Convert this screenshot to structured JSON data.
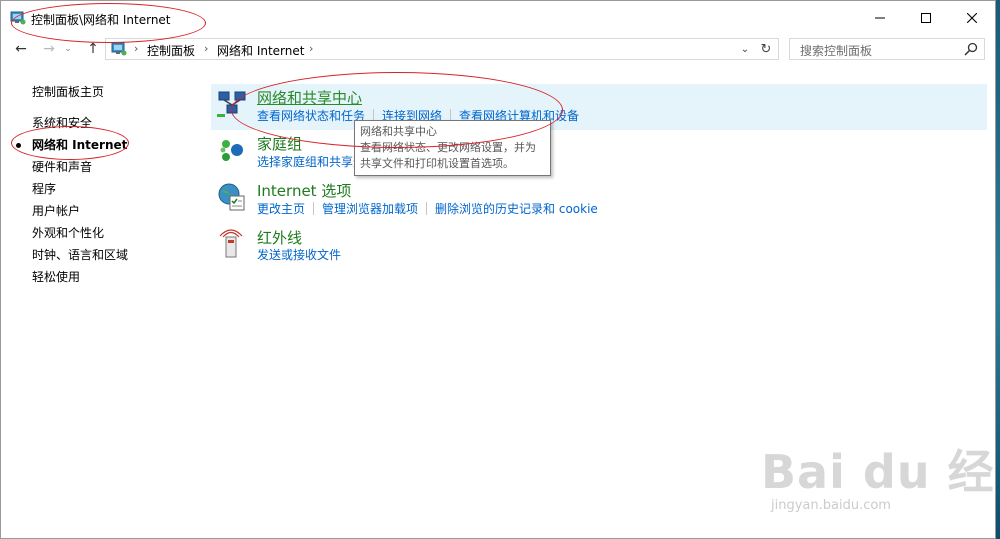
{
  "window": {
    "title": "控制面板\\网络和 Internet",
    "minimize_label": "minimize",
    "maximize_label": "maximize",
    "close_label": "close"
  },
  "address_bar": {
    "breadcrumbs": [
      "控制面板",
      "网络和 Internet"
    ],
    "separator": "›"
  },
  "search": {
    "placeholder": "搜索控制面板"
  },
  "sidebar": {
    "home": "控制面板主页",
    "items": [
      {
        "label": "系统和安全",
        "active": false
      },
      {
        "label": "网络和 Internet",
        "active": true
      },
      {
        "label": "硬件和声音",
        "active": false
      },
      {
        "label": "程序",
        "active": false
      },
      {
        "label": "用户帐户",
        "active": false
      },
      {
        "label": "外观和个性化",
        "active": false
      },
      {
        "label": "时钟、语言和区域",
        "active": false
      },
      {
        "label": "轻松使用",
        "active": false
      }
    ]
  },
  "categories": [
    {
      "title": "网络和共享中心",
      "icon": "network-sharing-center-icon",
      "links": [
        "查看网络状态和任务",
        "连接到网络",
        "查看网络计算机和设备"
      ]
    },
    {
      "title": "家庭组",
      "icon": "homegroup-icon",
      "links": [
        "选择家庭组和共享选项"
      ]
    },
    {
      "title": "Internet 选项",
      "icon": "internet-options-icon",
      "links": [
        "更改主页",
        "管理浏览器加载项",
        "删除浏览的历史记录和 cookie"
      ]
    },
    {
      "title": "红外线",
      "icon": "infrared-icon",
      "links": [
        "发送或接收文件"
      ]
    }
  ],
  "tooltip": {
    "lines": [
      "网络和共享中心",
      "查看网络状态、更改网络设置，并为",
      "共享文件和打印机设置首选项。"
    ]
  },
  "watermark": {
    "logo": "Bai du 经验",
    "url": "jingyan.baidu.com"
  },
  "colors": {
    "link": "#0066cc",
    "category_title": "#1e7a1e",
    "highlight": "#e5f3fb",
    "annotation": "#d8232a"
  }
}
